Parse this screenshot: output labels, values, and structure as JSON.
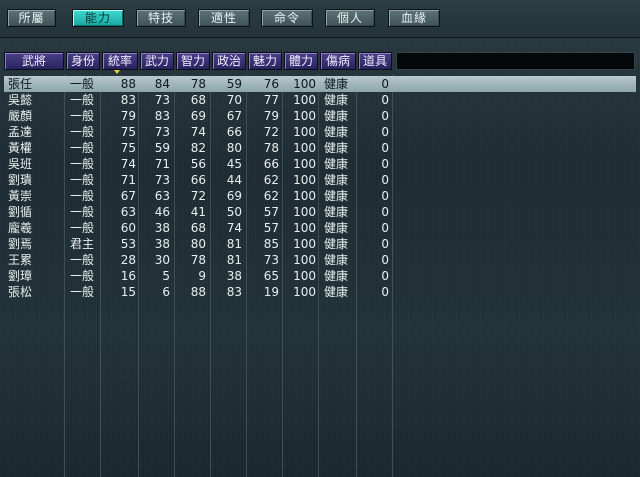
{
  "tabs": [
    {
      "label": "所屬",
      "active": false
    },
    {
      "label": "能力",
      "active": true
    },
    {
      "label": "特技",
      "active": false
    },
    {
      "label": "適性",
      "active": false
    },
    {
      "label": "命令",
      "active": false
    },
    {
      "label": "個人",
      "active": false
    },
    {
      "label": "血緣",
      "active": false
    }
  ],
  "table": {
    "columns": [
      "武將",
      "身份",
      "統率",
      "武力",
      "智力",
      "政治",
      "魅力",
      "體力",
      "傷病",
      "道具"
    ],
    "sorted_column": "統率",
    "selected_row": 0,
    "rows": [
      {
        "name": "張任",
        "rank": "一般",
        "lead": "88",
        "war": "84",
        "int": "78",
        "pol": "59",
        "cha": "76",
        "hp": "100",
        "health": "健康",
        "item": "0"
      },
      {
        "name": "吳懿",
        "rank": "一般",
        "lead": "83",
        "war": "73",
        "int": "68",
        "pol": "70",
        "cha": "77",
        "hp": "100",
        "health": "健康",
        "item": "0"
      },
      {
        "name": "嚴顏",
        "rank": "一般",
        "lead": "79",
        "war": "83",
        "int": "69",
        "pol": "67",
        "cha": "79",
        "hp": "100",
        "health": "健康",
        "item": "0"
      },
      {
        "name": "孟達",
        "rank": "一般",
        "lead": "75",
        "war": "73",
        "int": "74",
        "pol": "66",
        "cha": "72",
        "hp": "100",
        "health": "健康",
        "item": "0"
      },
      {
        "name": "黃權",
        "rank": "一般",
        "lead": "75",
        "war": "59",
        "int": "82",
        "pol": "80",
        "cha": "78",
        "hp": "100",
        "health": "健康",
        "item": "0"
      },
      {
        "name": "吳班",
        "rank": "一般",
        "lead": "74",
        "war": "71",
        "int": "56",
        "pol": "45",
        "cha": "66",
        "hp": "100",
        "health": "健康",
        "item": "0"
      },
      {
        "name": "劉璝",
        "rank": "一般",
        "lead": "71",
        "war": "73",
        "int": "66",
        "pol": "44",
        "cha": "62",
        "hp": "100",
        "health": "健康",
        "item": "0"
      },
      {
        "name": "黃崇",
        "rank": "一般",
        "lead": "67",
        "war": "63",
        "int": "72",
        "pol": "69",
        "cha": "62",
        "hp": "100",
        "health": "健康",
        "item": "0"
      },
      {
        "name": "劉循",
        "rank": "一般",
        "lead": "63",
        "war": "46",
        "int": "41",
        "pol": "50",
        "cha": "57",
        "hp": "100",
        "health": "健康",
        "item": "0"
      },
      {
        "name": "龐羲",
        "rank": "一般",
        "lead": "60",
        "war": "38",
        "int": "68",
        "pol": "74",
        "cha": "57",
        "hp": "100",
        "health": "健康",
        "item": "0"
      },
      {
        "name": "劉焉",
        "rank": "君主",
        "lead": "53",
        "war": "38",
        "int": "80",
        "pol": "81",
        "cha": "85",
        "hp": "100",
        "health": "健康",
        "item": "0"
      },
      {
        "name": "王累",
        "rank": "一般",
        "lead": "28",
        "war": "30",
        "int": "78",
        "pol": "81",
        "cha": "73",
        "hp": "100",
        "health": "健康",
        "item": "0"
      },
      {
        "name": "劉璋",
        "rank": "一般",
        "lead": "16",
        "war": "5",
        "int": "9",
        "pol": "38",
        "cha": "65",
        "hp": "100",
        "health": "健康",
        "item": "0"
      },
      {
        "name": "張松",
        "rank": "一般",
        "lead": "15",
        "war": "6",
        "int": "88",
        "pol": "83",
        "cha": "19",
        "hp": "100",
        "health": "健康",
        "item": "0"
      }
    ]
  },
  "colors": {
    "active_tab": "#16a8a0",
    "header": "#2b2360",
    "selected_row": "#a9bcbe"
  }
}
